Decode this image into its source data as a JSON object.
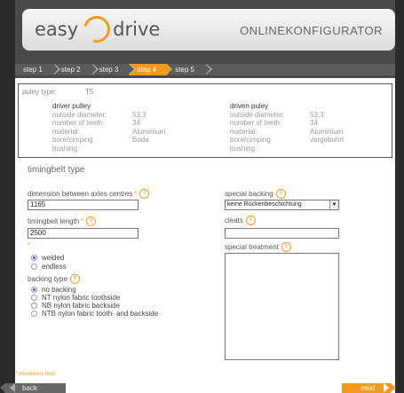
{
  "header": {
    "logo_left": "easy",
    "logo_right": "drive",
    "title": "ONLINEKONFIGURATOR"
  },
  "steps": [
    "step 1",
    "step 2",
    "step 3",
    "step 4",
    "step 5"
  ],
  "active_step": "step 4",
  "summary": {
    "pulley_type_label": "puley type:",
    "pulley_type_value": "T5",
    "driver": {
      "heading": "driver pulley",
      "rows": [
        {
          "k": "outside diameter:",
          "v": "53,3"
        },
        {
          "k": "number of teeth:",
          "v": "34"
        },
        {
          "k": "material:",
          "v": "Aluminium"
        },
        {
          "k": "bore/cimping",
          "v": "Boda"
        },
        {
          "k": "bushing:",
          "v": ""
        }
      ]
    },
    "driven": {
      "heading": "driven puley",
      "rows": [
        {
          "k": "outside diameter:",
          "v": "53,3"
        },
        {
          "k": "number of teeth:",
          "v": "34"
        },
        {
          "k": "material:",
          "v": "Aluminium"
        },
        {
          "k": "bore/cimping",
          "v": "vorgebohrt"
        },
        {
          "k": "bushing:",
          "v": ""
        }
      ]
    }
  },
  "form": {
    "section_title": "timingbelt type",
    "axes_label": "dimension between axles centres",
    "axes_value": "1165",
    "length_label": "timingbelt length",
    "length_value": "2500",
    "joint_options": [
      {
        "label": "welded",
        "selected": true
      },
      {
        "label": "endless",
        "selected": false
      }
    ],
    "backing_label": "backing type",
    "backing_options": [
      {
        "label": "no backing",
        "selected": true
      },
      {
        "label": "NT nylon fabric toothside",
        "selected": false
      },
      {
        "label": "NB nylon fabric backside",
        "selected": false
      },
      {
        "label": "NTB nylon fabric tooth- and backside",
        "selected": false
      }
    ],
    "special_backing_label": "special backing",
    "special_backing_value": "keine Rückenbeschichtung",
    "cleats_label": "cleats",
    "cleats_value": "",
    "special_treatment_label": "special treatment",
    "required_mark": "*",
    "info_glyph": "i"
  },
  "footer": {
    "mandatory_note": "* mondatory field",
    "back_label": "back",
    "next_label": "next"
  },
  "colors": {
    "accent": "#f39a1e",
    "dark_bg": "#2b2b2b"
  }
}
